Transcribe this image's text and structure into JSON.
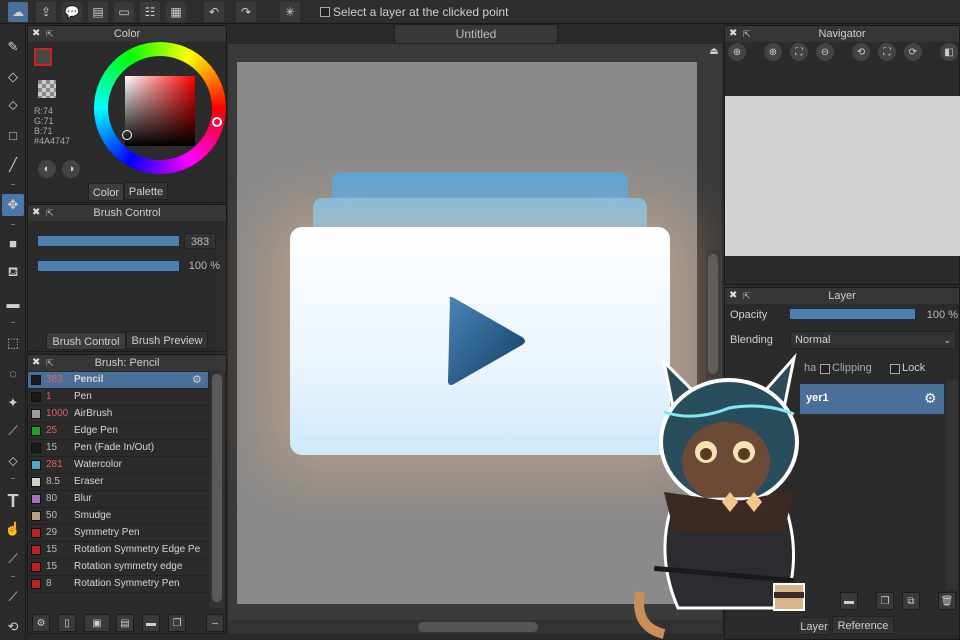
{
  "toolbar": {
    "option_label": "Select a layer at the clicked point"
  },
  "document": {
    "tab_title": "Untitled"
  },
  "color_panel": {
    "title": "Color",
    "rgb": {
      "r": "R:74",
      "g": "G:71",
      "b": "B:71",
      "hex": "#4A4747"
    },
    "tabs": [
      "Color",
      "Palette"
    ],
    "current_color": "#4A4747"
  },
  "brush_control": {
    "title": "Brush Control",
    "size": "383",
    "opacity": "100 %",
    "tabs": [
      "Brush Control",
      "Brush Preview"
    ]
  },
  "brush_list": {
    "title": "Brush: Pencil",
    "items": [
      {
        "size": "383",
        "name": "Pencil",
        "color": "#1a1a1a",
        "selected": true
      },
      {
        "size": "1",
        "name": "Pen",
        "color": "#1a1a1a"
      },
      {
        "size": "1000",
        "name": "AirBrush",
        "color": "#9a9a9a"
      },
      {
        "size": "25",
        "name": "Edge Pen",
        "color": "#1fa31f"
      },
      {
        "size": "15",
        "name": "Pen (Fade In/Out)",
        "color": "#1a1a1a"
      },
      {
        "size": "281",
        "name": "Watercolor",
        "color": "#4aa8c8"
      },
      {
        "size": "8.5",
        "name": "Eraser",
        "color": "#d0d0d0"
      },
      {
        "size": "80",
        "name": "Blur",
        "color": "#b070c0"
      },
      {
        "size": "50",
        "name": "Smudge",
        "color": "#b8a080"
      },
      {
        "size": "29",
        "name": "Symmetry Pen",
        "color": "#c02020"
      },
      {
        "size": "15",
        "name": "Rotation Symmetry Edge Pe",
        "color": "#c02020"
      },
      {
        "size": "15",
        "name": "Rotation symmetry edge",
        "color": "#c02020"
      },
      {
        "size": "8",
        "name": "Rotation Symmetry Pen",
        "color": "#c02020"
      }
    ]
  },
  "navigator": {
    "title": "Navigator"
  },
  "layer_panel": {
    "title": "Layer",
    "opacity_label": "Opacity",
    "opacity_value": "100 %",
    "blending_label": "Blending",
    "blending_value": "Normal",
    "alpha_label": "ha",
    "clipping_label": "Clipping",
    "lock_label": "Lock",
    "layer_name": "yer1",
    "tabs": [
      "Layer",
      "Reference"
    ]
  },
  "colors": {
    "accent": "#4a6f98",
    "slider": "#4f7fae"
  }
}
